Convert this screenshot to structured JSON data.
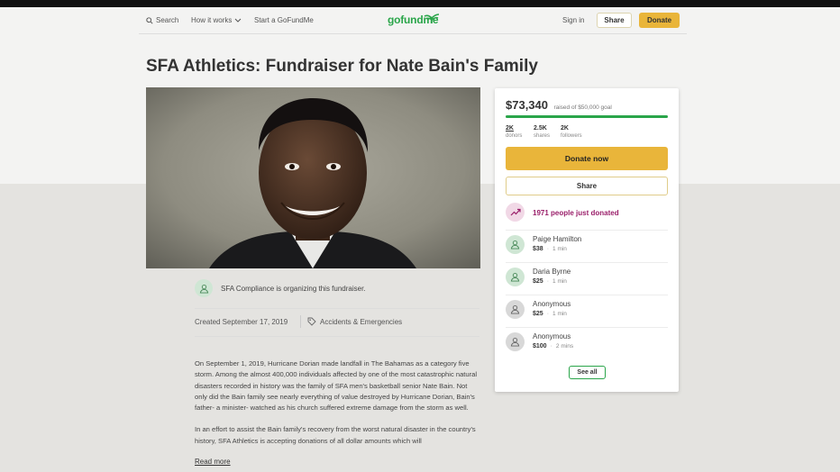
{
  "header": {
    "search_label": "Search",
    "how_it_works_label": "How it works",
    "start_label": "Start a GoFundMe",
    "logo_text": "gofundme",
    "signin_label": "Sign in",
    "share_label": "Share",
    "donate_label": "Donate"
  },
  "campaign": {
    "title": "SFA Athletics: Fundraiser for Nate Bain's Family",
    "organizer_text": "SFA Compliance is organizing this fundraiser.",
    "created": "Created September 17, 2019",
    "category": "Accidents & Emergencies",
    "story": [
      "On September 1, 2019, Hurricane Dorian made landfall in The Bahamas as a category five storm. Among the almost 400,000 individuals affected by one of the most catastrophic natural disasters recorded in history was the family of SFA men's basketball senior Nate Bain. Not only did the Bain family see nearly everything of value destroyed by Hurricane Dorian, Bain's father- a minister- watched as his church suffered extreme damage from the storm as well.",
      "In an effort to assist the Bain family's recovery from the worst natural disaster in the country's history, SFA Athletics is accepting donations of all dollar amounts which will"
    ],
    "read_more": "Read more"
  },
  "sidebar": {
    "raised_amount": "$73,340",
    "raised_goal": "raised of $50,000 goal",
    "progress_fraction": 1.0,
    "stats": {
      "donors": {
        "value": "2K",
        "label": "donors"
      },
      "shares": {
        "value": "2.5K",
        "label": "shares"
      },
      "followers": {
        "value": "2K",
        "label": "followers"
      }
    },
    "donate_now_label": "Donate now",
    "share_label": "Share",
    "recent_text": "1971 people just donated",
    "donors": [
      {
        "name": "Paige Hamilton",
        "amount": "$38",
        "time": "1 min"
      },
      {
        "name": "Daria Byrne",
        "amount": "$25",
        "time": "1 min"
      },
      {
        "name": "Anonymous",
        "amount": "$25",
        "time": "1 min"
      },
      {
        "name": "Anonymous",
        "amount": "$100",
        "time": "2 mins"
      }
    ],
    "see_all_label": "See all"
  },
  "colors": {
    "brand_green": "#2aa54a",
    "donate_yellow": "#e9b53a",
    "trend_purple": "#9a1f6a"
  }
}
